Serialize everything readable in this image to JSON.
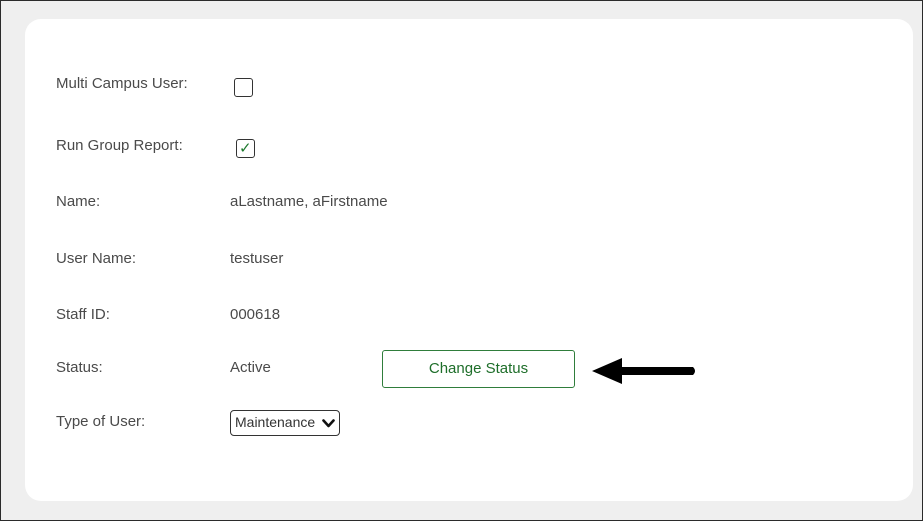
{
  "form": {
    "multi_campus": {
      "label": "Multi Campus User:",
      "checked": false
    },
    "run_group": {
      "label": "Run Group Report:",
      "checked": true
    },
    "name": {
      "label": "Name:",
      "value": "aLastname, aFirstname"
    },
    "user_name": {
      "label": "User Name:",
      "value": "testuser"
    },
    "staff_id": {
      "label": "Staff ID:",
      "value": "000618"
    },
    "status": {
      "label": "Status:",
      "value": "Active",
      "button_label": "Change Status"
    },
    "type_of_user": {
      "label": "Type of User:",
      "selected": "Maintenance"
    }
  },
  "icons": {
    "checkmark": "checkmark-icon",
    "arrow": "arrow-left-icon",
    "chevron": "chevron-down-icon"
  },
  "colors": {
    "button_border": "#2f7d3b",
    "button_text": "#1e6e2a",
    "checkmark": "#1d7a2e",
    "background": "#efefef"
  }
}
